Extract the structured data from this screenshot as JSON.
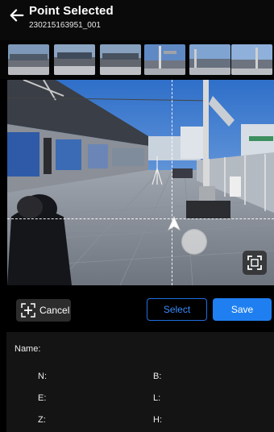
{
  "header": {
    "title": "Point Selected",
    "subtitle": "230215163951_001"
  },
  "thumbnails": {
    "count": 6
  },
  "icons": {
    "back": "arrow-left-icon",
    "cancel": "add-point-icon",
    "fullscreen": "fullscreen-icon"
  },
  "actions": {
    "cancel_label": "Cancel",
    "select_label": "Select",
    "save_label": "Save"
  },
  "info": {
    "name_label": "Name:",
    "n_label": "N:",
    "b_label": "B:",
    "e_label": "E:",
    "l_label": "L:",
    "z_label": "Z:",
    "h_label": "H:"
  },
  "colors": {
    "accent": "#1f7ff0",
    "background": "#000000",
    "panel": "#141414"
  }
}
